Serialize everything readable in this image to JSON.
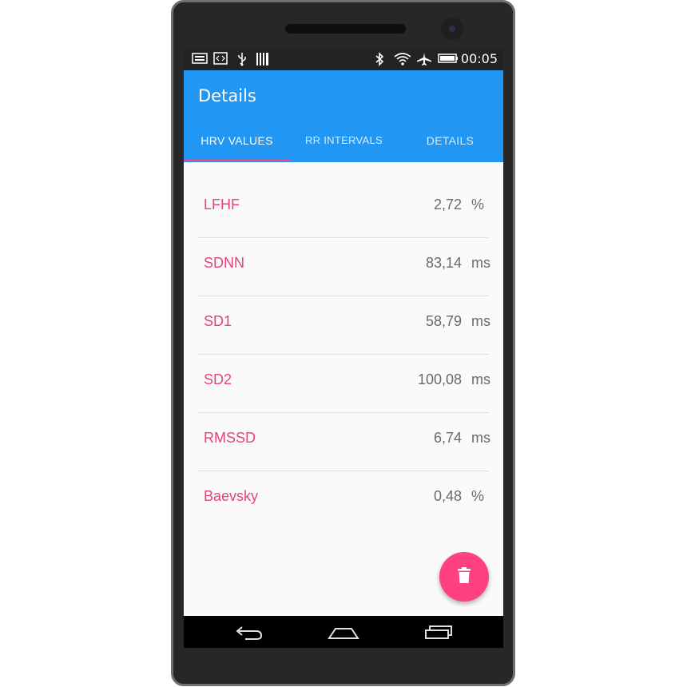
{
  "status_bar": {
    "time": "00:05",
    "icons": [
      "keyboard-icon",
      "code-icon",
      "usb-icon",
      "barcode-icon",
      "bluetooth-icon",
      "wifi-icon",
      "airplane-icon",
      "battery-icon"
    ]
  },
  "app_bar": {
    "title": "Details",
    "tabs": [
      {
        "label": "HRV VALUES",
        "selected": true
      },
      {
        "label": "RR INTERVALS",
        "selected": false
      },
      {
        "label": "DETAILS",
        "selected": false
      }
    ]
  },
  "hrv_values": [
    {
      "name": "LFHF",
      "value": "2,72",
      "unit": "%"
    },
    {
      "name": "SDNN",
      "value": "83,14",
      "unit": "ms"
    },
    {
      "name": "SD1",
      "value": "58,79",
      "unit": "ms"
    },
    {
      "name": "SD2",
      "value": "100,08",
      "unit": "ms"
    },
    {
      "name": "RMSSD",
      "value": "6,74",
      "unit": "ms"
    },
    {
      "name": "Baevsky",
      "value": "0,48",
      "unit": "%"
    }
  ],
  "fab": {
    "icon": "delete-icon"
  },
  "nav_bar": {
    "icons": [
      "back-icon",
      "home-icon",
      "recents-icon"
    ]
  },
  "colors": {
    "primary": "#2196f3",
    "accent": "#ff4081",
    "label": "#e8417e"
  }
}
